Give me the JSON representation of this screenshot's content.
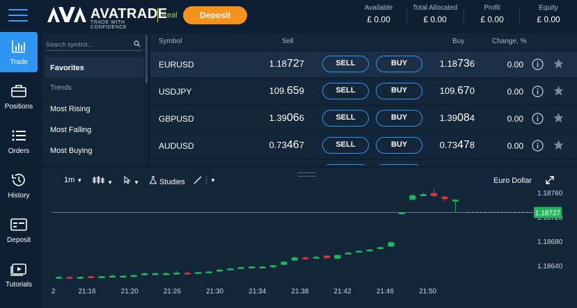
{
  "brand": {
    "name": "AVATRADE",
    "tagline": "TRADE WITH CONFIDENCE"
  },
  "header": {
    "account_mode": "Real",
    "deposit_label": "Deposit",
    "stats": [
      {
        "label": "Available",
        "value": "£ 0.00"
      },
      {
        "label": "Total Allocated",
        "value": "£ 0.00"
      },
      {
        "label": "Profit",
        "value": "£ 0.00"
      },
      {
        "label": "Equity",
        "value": "£ 0.00"
      }
    ]
  },
  "nav": [
    {
      "label": "Trade",
      "icon": "chart-bars-icon",
      "active": true
    },
    {
      "label": "Positions",
      "icon": "briefcase-icon"
    },
    {
      "label": "Orders",
      "icon": "list-icon"
    },
    {
      "label": "History",
      "icon": "history-icon"
    },
    {
      "label": "Deposit",
      "icon": "card-icon"
    },
    {
      "label": "Tutorials",
      "icon": "video-icon"
    }
  ],
  "symbols_panel": {
    "search_placeholder": "Search symbol...",
    "favorites": "Favorites",
    "trends_heading": "Trends",
    "items": [
      "Most Rising",
      "Most Falling",
      "Most Buying"
    ]
  },
  "table": {
    "headers": {
      "symbol": "Symbol",
      "sell": "Sell",
      "buy": "Buy",
      "change": "Change, %"
    },
    "sell_label": "SELL",
    "buy_label": "BUY",
    "rows": [
      {
        "symbol": "EURUSD",
        "sell_main": "1.18",
        "sell_big": "72",
        "sell_small": "7",
        "buy_main": "1.18",
        "buy_big": "73",
        "buy_small": "6",
        "change": "0.00"
      },
      {
        "symbol": "USDJPY",
        "sell_main": "109.",
        "sell_big": "65",
        "sell_small": "9",
        "buy_main": "109.",
        "buy_big": "67",
        "buy_small": "0",
        "change": "0.00"
      },
      {
        "symbol": "GBPUSD",
        "sell_main": "1.39",
        "sell_big": "06",
        "sell_small": "6",
        "buy_main": "1.39",
        "buy_big": "08",
        "buy_small": "4",
        "change": "0.00"
      },
      {
        "symbol": "AUDUSD",
        "sell_main": "0.73",
        "sell_big": "46",
        "sell_small": "7",
        "buy_main": "0.73",
        "buy_big": "47",
        "buy_small": "8",
        "change": "0.00"
      }
    ]
  },
  "chart_toolbar": {
    "interval": "1m",
    "studies": "Studies",
    "instrument_name": "Euro Dollar"
  },
  "chart_data": {
    "type": "candlestick",
    "x_ticks": [
      "21:16",
      "21:20",
      "21:26",
      "21:30",
      "21:34",
      "21:38",
      "21:42",
      "21:46",
      "21:50"
    ],
    "y_ticks": [
      "1.18760",
      "1.18720",
      "1.18680",
      "1.18640"
    ],
    "current_price": "1.18727",
    "ylim": [
      1.1861,
      1.1877
    ],
    "up_color": "#1fb85c",
    "down_color": "#e23232",
    "candles": [
      {
        "o": 1.1862,
        "c": 1.18621,
        "h": 1.18622,
        "l": 1.18619
      },
      {
        "o": 1.18621,
        "c": 1.1862,
        "h": 1.18622,
        "l": 1.18619
      },
      {
        "o": 1.1862,
        "c": 1.18621,
        "h": 1.18622,
        "l": 1.18619
      },
      {
        "o": 1.18622,
        "c": 1.18621,
        "h": 1.18623,
        "l": 1.1862
      },
      {
        "o": 1.18621,
        "c": 1.18622,
        "h": 1.18623,
        "l": 1.1862
      },
      {
        "o": 1.18622,
        "c": 1.18623,
        "h": 1.18624,
        "l": 1.18621
      },
      {
        "o": 1.18623,
        "c": 1.18623,
        "h": 1.18624,
        "l": 1.18622
      },
      {
        "o": 1.18624,
        "c": 1.18624,
        "h": 1.18625,
        "l": 1.18623
      },
      {
        "o": 1.18624,
        "c": 1.18627,
        "h": 1.18628,
        "l": 1.18623
      },
      {
        "o": 1.18626,
        "c": 1.18627,
        "h": 1.18628,
        "l": 1.18625
      },
      {
        "o": 1.18626,
        "c": 1.18627,
        "h": 1.18628,
        "l": 1.18625
      },
      {
        "o": 1.18627,
        "c": 1.18628,
        "h": 1.18631,
        "l": 1.18626
      },
      {
        "o": 1.18628,
        "c": 1.18627,
        "h": 1.18629,
        "l": 1.18626
      },
      {
        "o": 1.18627,
        "c": 1.18629,
        "h": 1.1863,
        "l": 1.18626
      },
      {
        "o": 1.18629,
        "c": 1.1863,
        "h": 1.18631,
        "l": 1.18628
      },
      {
        "o": 1.1863,
        "c": 1.18633,
        "h": 1.18634,
        "l": 1.18629
      },
      {
        "o": 1.18633,
        "c": 1.18635,
        "h": 1.18636,
        "l": 1.18632
      },
      {
        "o": 1.18636,
        "c": 1.18637,
        "h": 1.18638,
        "l": 1.18635
      },
      {
        "o": 1.18637,
        "c": 1.18638,
        "h": 1.18639,
        "l": 1.18636
      },
      {
        "o": 1.18638,
        "c": 1.18638,
        "h": 1.18639,
        "l": 1.18637
      },
      {
        "o": 1.18637,
        "c": 1.1864,
        "h": 1.18641,
        "l": 1.18636
      },
      {
        "o": 1.18641,
        "c": 1.18646,
        "h": 1.18648,
        "l": 1.1864
      },
      {
        "o": 1.18648,
        "c": 1.18653,
        "h": 1.18655,
        "l": 1.18647
      },
      {
        "o": 1.18653,
        "c": 1.1865,
        "h": 1.18655,
        "l": 1.18649
      },
      {
        "o": 1.18652,
        "c": 1.18654,
        "h": 1.18656,
        "l": 1.18651
      },
      {
        "o": 1.18656,
        "c": 1.18652,
        "h": 1.18657,
        "l": 1.18651
      },
      {
        "o": 1.18651,
        "c": 1.18657,
        "h": 1.18658,
        "l": 1.1865
      },
      {
        "o": 1.18659,
        "c": 1.18661,
        "h": 1.18662,
        "l": 1.18658
      },
      {
        "o": 1.18662,
        "c": 1.18664,
        "h": 1.18665,
        "l": 1.18661
      },
      {
        "o": 1.18665,
        "c": 1.18666,
        "h": 1.18667,
        "l": 1.18664
      },
      {
        "o": 1.18667,
        "c": 1.1867,
        "h": 1.18671,
        "l": 1.18666
      },
      {
        "o": 1.18671,
        "c": 1.18678,
        "h": 1.1868,
        "l": 1.1867
      },
      {
        "o": 1.18727,
        "c": 1.18727,
        "h": 1.18728,
        "l": 1.18726
      },
      {
        "o": 1.18748,
        "c": 1.18755,
        "h": 1.18757,
        "l": 1.18747
      },
      {
        "o": 1.18754,
        "c": 1.18757,
        "h": 1.18759,
        "l": 1.18753
      },
      {
        "o": 1.18759,
        "c": 1.18754,
        "h": 1.18766,
        "l": 1.18752
      },
      {
        "o": 1.18753,
        "c": 1.18749,
        "h": 1.18755,
        "l": 1.18745
      },
      {
        "o": 1.18748,
        "c": 1.18748,
        "h": 1.18749,
        "l": 1.18727
      }
    ]
  }
}
